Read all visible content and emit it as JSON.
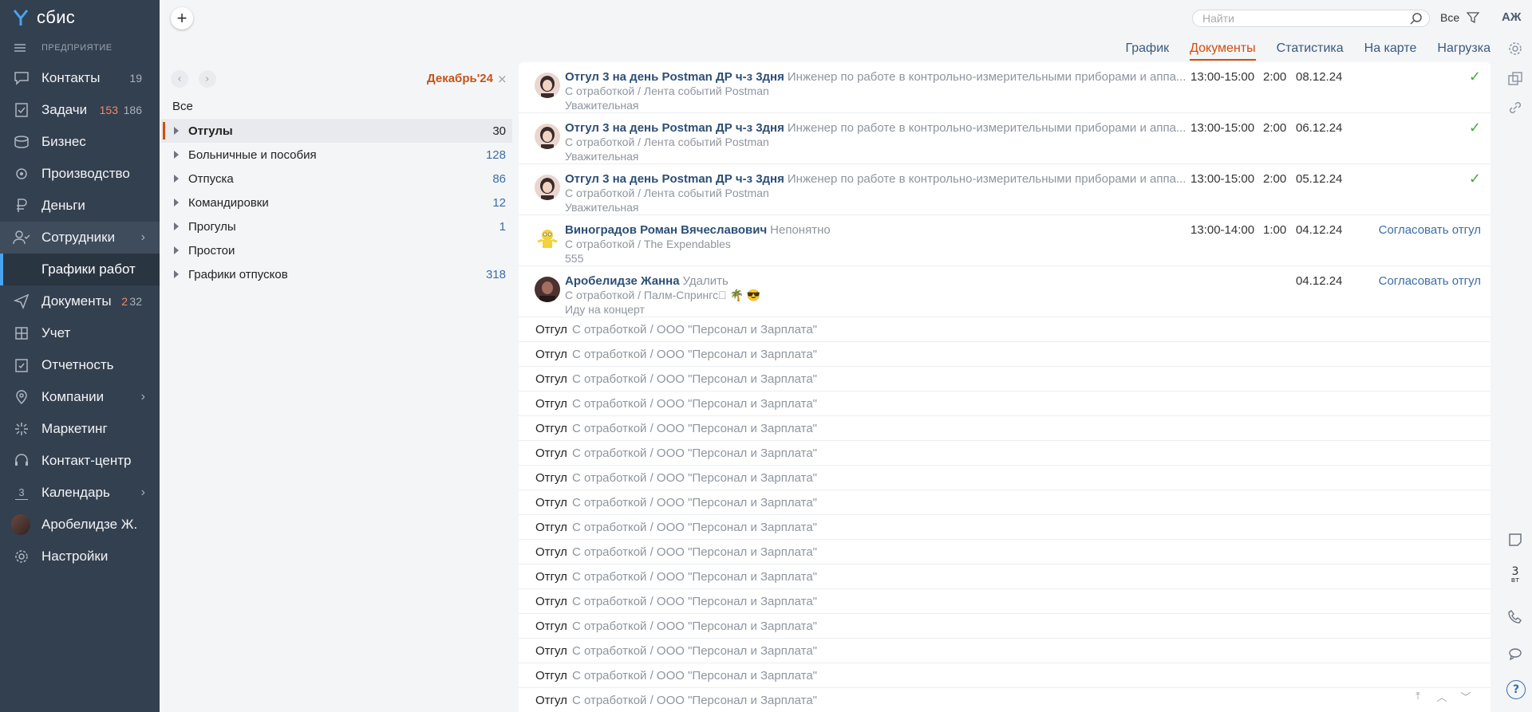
{
  "app": {
    "logo_text": "сбис",
    "org_label": "ПРЕДПРИЯТИЕ",
    "brand_color": "#33404f",
    "accent_color": "#d14e0d"
  },
  "sidebar": {
    "items": [
      {
        "label": "Контакты",
        "count": "19",
        "icon": "chat-icon"
      },
      {
        "label": "Задачи",
        "count_red": "153",
        "count": "186",
        "icon": "tasks-icon"
      },
      {
        "label": "Бизнес",
        "icon": "business-icon"
      },
      {
        "label": "Производство",
        "icon": "production-icon"
      },
      {
        "label": "Деньги",
        "icon": "money-icon"
      },
      {
        "label": "Сотрудники",
        "icon": "employees-icon",
        "chevron": true
      },
      {
        "label": "Документы",
        "count_red": "2",
        "count": "32",
        "icon": "documents-icon"
      },
      {
        "label": "Учет",
        "icon": "accounting-icon"
      },
      {
        "label": "Отчетность",
        "icon": "reports-icon"
      },
      {
        "label": "Компании",
        "icon": "companies-icon",
        "chevron": true
      },
      {
        "label": "Маркетинг",
        "icon": "marketing-icon"
      },
      {
        "label": "Контакт-центр",
        "icon": "headset-icon"
      },
      {
        "label": "Календарь",
        "icon": "calendar-icon",
        "chevron": true,
        "cal_day": "3"
      },
      {
        "label": "Аробелидзе Ж.",
        "icon": "avatar"
      },
      {
        "label": "Настройки",
        "icon": "settings-icon"
      }
    ],
    "subitem": "Графики работ"
  },
  "topbar": {
    "add_label": "+",
    "search_placeholder": "Найти",
    "filter_label": "Все",
    "user_initials": "АЖ"
  },
  "tabs": [
    {
      "label": "График",
      "active": false
    },
    {
      "label": "Документы",
      "active": true
    },
    {
      "label": "Статистика",
      "active": false
    },
    {
      "label": "На карте",
      "active": false
    },
    {
      "label": "Нагрузка",
      "active": false
    }
  ],
  "filter_panel": {
    "prev": "‹",
    "next": "›",
    "period": "Декабрь'24",
    "close": "×",
    "all_label": "Все",
    "groups": [
      {
        "label": "Отгулы",
        "count": "30",
        "selected": true
      },
      {
        "label": "Больничные и пособия",
        "count": "128"
      },
      {
        "label": "Отпуска",
        "count": "86"
      },
      {
        "label": "Командировки",
        "count": "12"
      },
      {
        "label": "Прогулы",
        "count": "1"
      },
      {
        "label": "Простои",
        "count": ""
      },
      {
        "label": "Графики отпусков",
        "count": "318"
      }
    ]
  },
  "documents": [
    {
      "title": "Отгул 3 на день Postman ДР ч-з 3дня",
      "desc": "Инженер по работе в контрольно-измерительными приборами и аппа...",
      "sub": "С отработкой / Лента событий Postman",
      "note": "Уважительная",
      "time": "13:00-15:00",
      "dur": "2:00",
      "date": "08.12.24",
      "status": "✓",
      "avatar": "woman"
    },
    {
      "title": "Отгул 3 на день Postman ДР ч-з 3дня",
      "desc": "Инженер по работе в контрольно-измерительными приборами и аппа...",
      "sub": "С отработкой / Лента событий Postman",
      "note": "Уважительная",
      "time": "13:00-15:00",
      "dur": "2:00",
      "date": "06.12.24",
      "status": "✓",
      "avatar": "woman"
    },
    {
      "title": "Отгул 3 на день Postman ДР ч-з 3дня",
      "desc": "Инженер по работе в контрольно-измерительными приборами и аппа...",
      "sub": "С отработкой / Лента событий Postman",
      "note": "Уважительная",
      "time": "13:00-15:00",
      "dur": "2:00",
      "date": "05.12.24",
      "status": "✓",
      "avatar": "woman"
    },
    {
      "title": "Виноградов Роман Вячеславович",
      "desc": "Непонятно",
      "sub": "С отработкой / The Expendables",
      "note": "555",
      "time": "13:00-14:00",
      "dur": "1:00",
      "date": "04.12.24",
      "status": "Согласовать отгул",
      "avatar": "cartoon"
    },
    {
      "title": "Аробелидзе Жанна",
      "desc": "Удалить",
      "sub": "С отработкой / Палм-Спрингс🏼 🌴 😎",
      "note": "Иду на концерт",
      "time": "",
      "dur": "",
      "date": "04.12.24",
      "status": "Согласовать отгул",
      "avatar": "photo"
    }
  ],
  "simple_rows": [
    {
      "type": "Отгул",
      "desc": "С отработкой / ООО \"Персонал и Зарплата\""
    },
    {
      "type": "Отгул",
      "desc": "С отработкой / ООО \"Персонал и Зарплата\""
    },
    {
      "type": "Отгул",
      "desc": "С отработкой / ООО \"Персонал и Зарплата\""
    },
    {
      "type": "Отгул",
      "desc": "С отработкой / ООО \"Персонал и Зарплата\""
    },
    {
      "type": "Отгул",
      "desc": "С отработкой / ООО \"Персонал и Зарплата\""
    },
    {
      "type": "Отгул",
      "desc": "С отработкой / ООО \"Персонал и Зарплата\""
    },
    {
      "type": "Отгул",
      "desc": "С отработкой / ООО \"Персонал и Зарплата\""
    },
    {
      "type": "Отгул",
      "desc": "С отработкой / ООО \"Персонал и Зарплата\""
    },
    {
      "type": "Отгул",
      "desc": "С отработкой / ООО \"Персонал и Зарплата\""
    },
    {
      "type": "Отгул",
      "desc": "С отработкой / ООО \"Персонал и Зарплата\""
    },
    {
      "type": "Отгул",
      "desc": "С отработкой / ООО \"Персонал и Зарплата\""
    },
    {
      "type": "Отгул",
      "desc": "С отработкой / ООО \"Персонал и Зарплата\""
    },
    {
      "type": "Отгул",
      "desc": "С отработкой / ООО \"Персонал и Зарплата\""
    },
    {
      "type": "Отгул",
      "desc": "С отработкой / ООО \"Персонал и Зарплата\""
    },
    {
      "type": "Отгул",
      "desc": "С отработкой / ООО \"Персонал и Зарплата\""
    },
    {
      "type": "Отгул",
      "desc": "С отработкой / ООО \"Персонал и Зарплата\""
    }
  ],
  "right_rail": {
    "calendar_day": "3",
    "calendar_weekday": "вт",
    "help": "?"
  },
  "scroll": {
    "top": "⤒",
    "up": "︿",
    "down": "﹀"
  }
}
